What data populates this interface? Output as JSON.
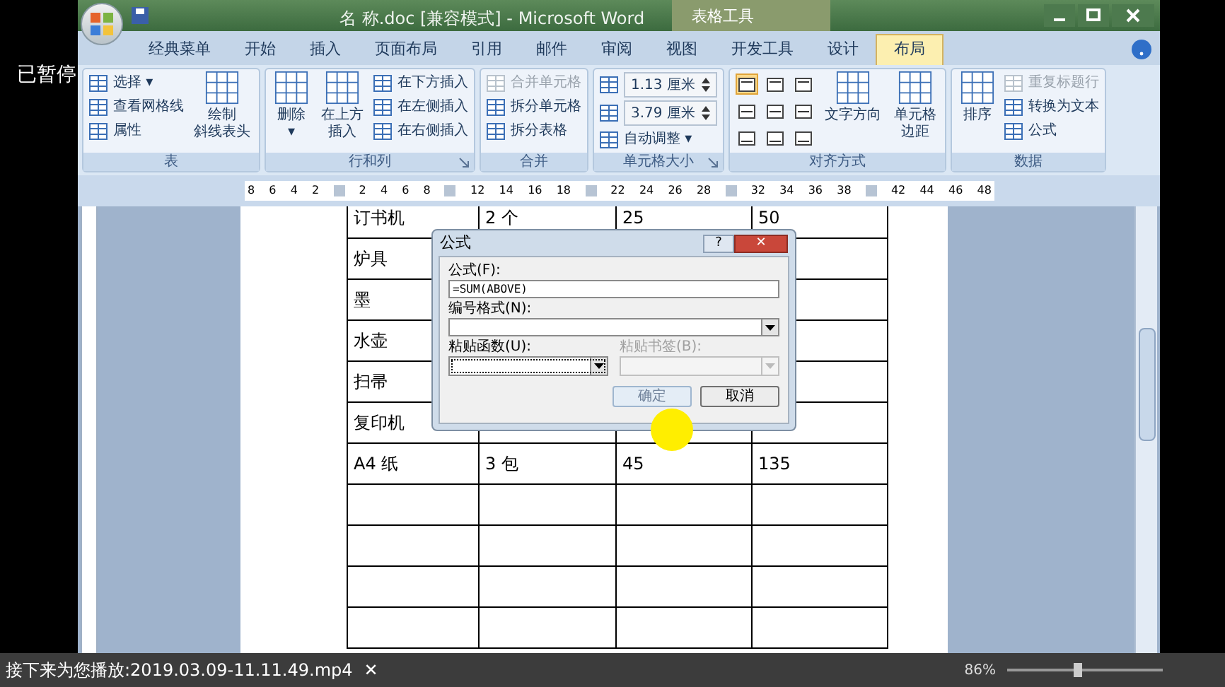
{
  "overlay": {
    "paused": "已暂停"
  },
  "window": {
    "title": "名 称.doc [兼容模式] - Microsoft Word",
    "context_tab_title": "表格工具"
  },
  "tabs": [
    {
      "label": "经典菜单",
      "selected": false
    },
    {
      "label": "开始",
      "selected": false
    },
    {
      "label": "插入",
      "selected": false
    },
    {
      "label": "页面布局",
      "selected": false
    },
    {
      "label": "引用",
      "selected": false
    },
    {
      "label": "邮件",
      "selected": false
    },
    {
      "label": "审阅",
      "selected": false
    },
    {
      "label": "视图",
      "selected": false
    },
    {
      "label": "开发工具",
      "selected": false
    },
    {
      "label": "设计",
      "selected": false
    },
    {
      "label": "布局",
      "selected": true
    }
  ],
  "ribbon_groups": [
    {
      "label": "表",
      "launcher": false,
      "columns": [
        [
          {
            "kind": "small",
            "text": "选择 ▾",
            "disabled": false
          },
          {
            "kind": "small",
            "text": "查看网格线",
            "disabled": false
          },
          {
            "kind": "small",
            "text": "属性",
            "disabled": false
          }
        ],
        [
          {
            "kind": "large",
            "lines": [
              "绘制",
              "斜线表头"
            ],
            "disabled": false
          }
        ]
      ]
    },
    {
      "label": "行和列",
      "launcher": true,
      "columns": [
        [
          {
            "kind": "large",
            "lines": [
              "删除",
              "▾"
            ],
            "disabled": false
          }
        ],
        [
          {
            "kind": "large",
            "lines": [
              "在上方",
              "插入"
            ],
            "disabled": false
          }
        ],
        [
          {
            "kind": "small",
            "text": "在下方插入",
            "disabled": false
          },
          {
            "kind": "small",
            "text": "在左侧插入",
            "disabled": false
          },
          {
            "kind": "small",
            "text": "在右侧插入",
            "disabled": false
          }
        ]
      ]
    },
    {
      "label": "合并",
      "launcher": false,
      "columns": [
        [
          {
            "kind": "small",
            "text": "合并单元格",
            "disabled": true
          },
          {
            "kind": "small",
            "text": "拆分单元格",
            "disabled": false
          },
          {
            "kind": "small",
            "text": "拆分表格",
            "disabled": false
          }
        ]
      ]
    },
    {
      "label": "单元格大小",
      "launcher": true,
      "columns": [
        [
          {
            "kind": "spin",
            "text": "1.13 厘米"
          },
          {
            "kind": "spin",
            "text": "3.79 厘米"
          },
          {
            "kind": "small",
            "text": "自动调整 ▾",
            "disabled": false
          }
        ]
      ]
    },
    {
      "label": "对齐方式",
      "launcher": false,
      "columns": [
        [
          {
            "kind": "align",
            "cells": [
              {
                "selected": true
              },
              {
                "selected": false
              },
              {
                "selected": false
              },
              {
                "selected": false
              },
              {
                "selected": false
              },
              {
                "selected": false
              },
              {
                "selected": false
              },
              {
                "selected": false
              },
              {
                "selected": false
              }
            ]
          }
        ],
        [
          {
            "kind": "large",
            "lines": [
              "文字方向"
            ],
            "disabled": false
          }
        ],
        [
          {
            "kind": "large",
            "lines": [
              "单元格",
              "边距"
            ],
            "disabled": false
          }
        ]
      ]
    },
    {
      "label": "数据",
      "launcher": false,
      "columns": [
        [
          {
            "kind": "large",
            "lines": [
              "排序"
            ],
            "disabled": false
          }
        ],
        [
          {
            "kind": "small",
            "text": "重复标题行",
            "disabled": true
          },
          {
            "kind": "small",
            "text": "转换为文本",
            "disabled": false
          },
          {
            "kind": "small",
            "text": "公式",
            "disabled": false
          }
        ]
      ]
    }
  ],
  "ruler": [
    {
      "kind": "num",
      "text": "8"
    },
    {
      "kind": "num",
      "text": "6"
    },
    {
      "kind": "num",
      "text": "4"
    },
    {
      "kind": "num",
      "text": "2"
    },
    {
      "kind": "marker"
    },
    {
      "kind": "num",
      "text": "2"
    },
    {
      "kind": "num",
      "text": "4"
    },
    {
      "kind": "num",
      "text": "6"
    },
    {
      "kind": "num",
      "text": "8"
    },
    {
      "kind": "marker"
    },
    {
      "kind": "num",
      "text": "12"
    },
    {
      "kind": "num",
      "text": "14"
    },
    {
      "kind": "num",
      "text": "16"
    },
    {
      "kind": "num",
      "text": "18"
    },
    {
      "kind": "marker"
    },
    {
      "kind": "num",
      "text": "22"
    },
    {
      "kind": "num",
      "text": "24"
    },
    {
      "kind": "num",
      "text": "26"
    },
    {
      "kind": "num",
      "text": "28"
    },
    {
      "kind": "marker"
    },
    {
      "kind": "num",
      "text": "32"
    },
    {
      "kind": "num",
      "text": "34"
    },
    {
      "kind": "num",
      "text": "36"
    },
    {
      "kind": "num",
      "text": "38"
    },
    {
      "kind": "marker"
    },
    {
      "kind": "num",
      "text": "42"
    },
    {
      "kind": "num",
      "text": "44"
    },
    {
      "kind": "num",
      "text": "46"
    },
    {
      "kind": "num",
      "text": "48"
    }
  ],
  "table": {
    "rows": [
      [
        "订书机",
        "2 个",
        "25",
        "50"
      ],
      [
        "炉具"
      ],
      [
        "墨"
      ],
      [
        "水壶"
      ],
      [
        "扫帚"
      ],
      [
        "复印机"
      ],
      [
        "A4 纸",
        "3 包",
        "45",
        "135"
      ],
      [
        "",
        "",
        "",
        ""
      ],
      [
        "",
        "",
        "",
        ""
      ],
      [
        "",
        "",
        "",
        ""
      ],
      [
        "",
        "",
        "",
        ""
      ]
    ]
  },
  "dialog": {
    "title": "公式",
    "help": "?",
    "close": "✕",
    "fields": [
      {
        "kind": "text",
        "label": "公式(F):",
        "value": "=SUM(ABOVE)"
      },
      {
        "kind": "dropdown",
        "label": "编号格式(N):"
      }
    ],
    "paste": [
      {
        "label": "粘贴函数(U):",
        "disabled": false
      },
      {
        "label": "粘贴书签(B):",
        "disabled": true
      }
    ],
    "buttons": [
      {
        "label": "确定",
        "disabled": true
      },
      {
        "label": "取消",
        "disabled": false
      }
    ]
  },
  "player_bar": {
    "next": "接下来为您播放:2019.03.09-11.11.49.mp4",
    "close": "✕",
    "zoom": "86%",
    "zoom_slider": {
      "level": 0.45
    }
  }
}
